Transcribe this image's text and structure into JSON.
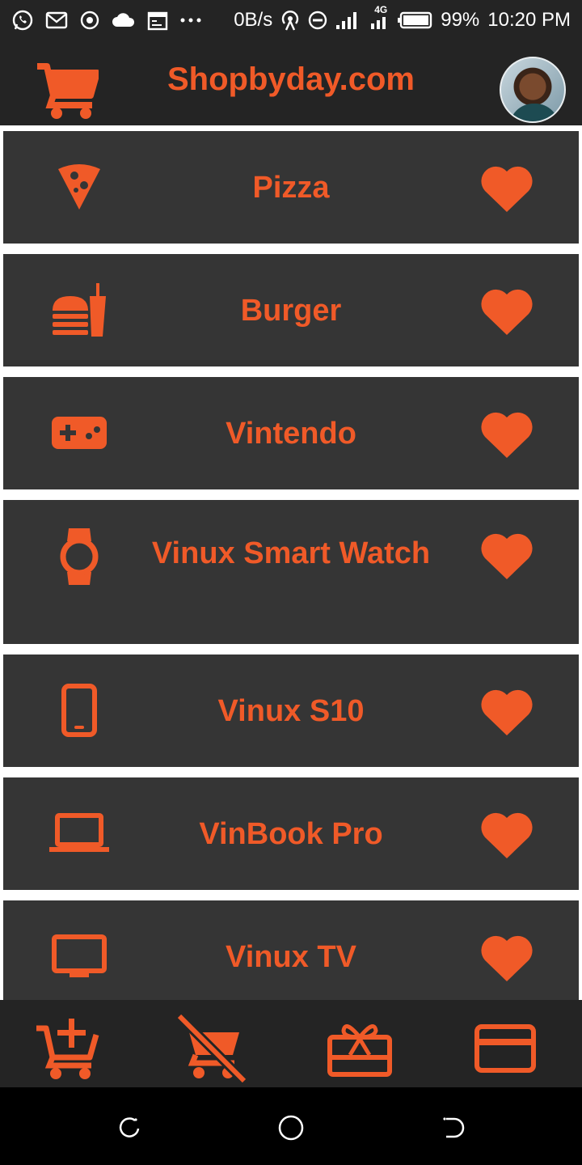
{
  "status_bar": {
    "network_speed": "0B/s",
    "network_type": "4G",
    "battery": "99%",
    "time": "10:20 PM",
    "left_icons": [
      "whatsapp-icon",
      "gmail-icon",
      "record-icon",
      "cloud-icon",
      "calendar-icon",
      "more-dots-icon"
    ]
  },
  "app_bar": {
    "title": "Shopbyday.com",
    "logo_icon": "cart-icon",
    "avatar": "user-avatar"
  },
  "items": [
    {
      "label": "Pizza",
      "icon": "pizza-icon"
    },
    {
      "label": "Burger",
      "icon": "burger-drink-icon"
    },
    {
      "label": "Vintendo",
      "icon": "gamepad-icon"
    },
    {
      "label": "Vinux Smart Watch",
      "icon": "smartwatch-icon"
    },
    {
      "label": "Vinux S10",
      "icon": "phone-icon"
    },
    {
      "label": "VinBook Pro",
      "icon": "laptop-icon"
    },
    {
      "label": "Vinux TV",
      "icon": "tv-icon"
    }
  ],
  "bottom_nav": [
    "add-to-cart-icon",
    "remove-from-cart-icon",
    "gift-card-icon",
    "credit-card-icon"
  ],
  "system_nav": [
    "recent-apps-icon",
    "home-icon",
    "back-icon"
  ],
  "colors": {
    "accent": "#f05a28",
    "bar_bg": "#242424",
    "row_bg": "#353535"
  }
}
